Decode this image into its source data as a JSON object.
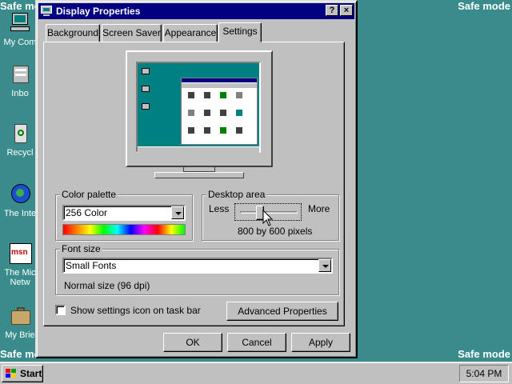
{
  "desktop": {
    "safe_mode_label": "Safe mode",
    "icons": [
      {
        "label": "My Com",
        "icon": "my-computer-icon"
      },
      {
        "label": "Inbo",
        "icon": "inbox-icon"
      },
      {
        "label": "Recycl",
        "icon": "recycle-bin-icon"
      },
      {
        "label": "The Inte",
        "icon": "internet-icon"
      },
      {
        "label": "The Mic",
        "label2": "Netw",
        "icon": "msn-icon"
      },
      {
        "label": "My Brie",
        "icon": "briefcase-icon"
      }
    ]
  },
  "window": {
    "title": "Display Properties",
    "help_button": "?",
    "close_button": "×",
    "tabs": [
      {
        "label": "Background"
      },
      {
        "label": "Screen Saver"
      },
      {
        "label": "Appearance"
      },
      {
        "label": "Settings",
        "active": true
      }
    ],
    "color_palette": {
      "legend": "Color palette",
      "value": "256 Color"
    },
    "desktop_area": {
      "legend": "Desktop area",
      "less_label": "Less",
      "more_label": "More",
      "resolution_text": "800 by 600 pixels",
      "slider_fraction": 0.33
    },
    "font_size": {
      "legend": "Font size",
      "value": "Small Fonts",
      "note": "Normal size (96 dpi)"
    },
    "show_settings_icon": {
      "label": "Show settings icon on task bar",
      "checked": false
    },
    "advanced_button": "Advanced Properties",
    "ok_button": "OK",
    "cancel_button": "Cancel",
    "apply_button": "Apply"
  },
  "taskbar": {
    "start_label": "Start",
    "clock": "5:04 PM"
  }
}
